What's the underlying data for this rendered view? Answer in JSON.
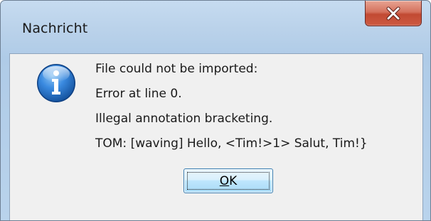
{
  "window": {
    "title": "Nachricht"
  },
  "icons": {
    "info": "information-icon",
    "close": "close-icon"
  },
  "message": {
    "lines": [
      "File could not be imported:",
      "Error at line 0.",
      "Illegal annotation bracketing.",
      "TOM: [waving] Hello, <Tim!>1> Salut, Tim!}"
    ]
  },
  "buttons": {
    "ok_mnemonic": "O",
    "ok_rest": "K"
  },
  "colors": {
    "close_button_red": "#c24a33",
    "info_icon_blue": "#1f68b8",
    "dialog_background": "#f0f0f0"
  }
}
